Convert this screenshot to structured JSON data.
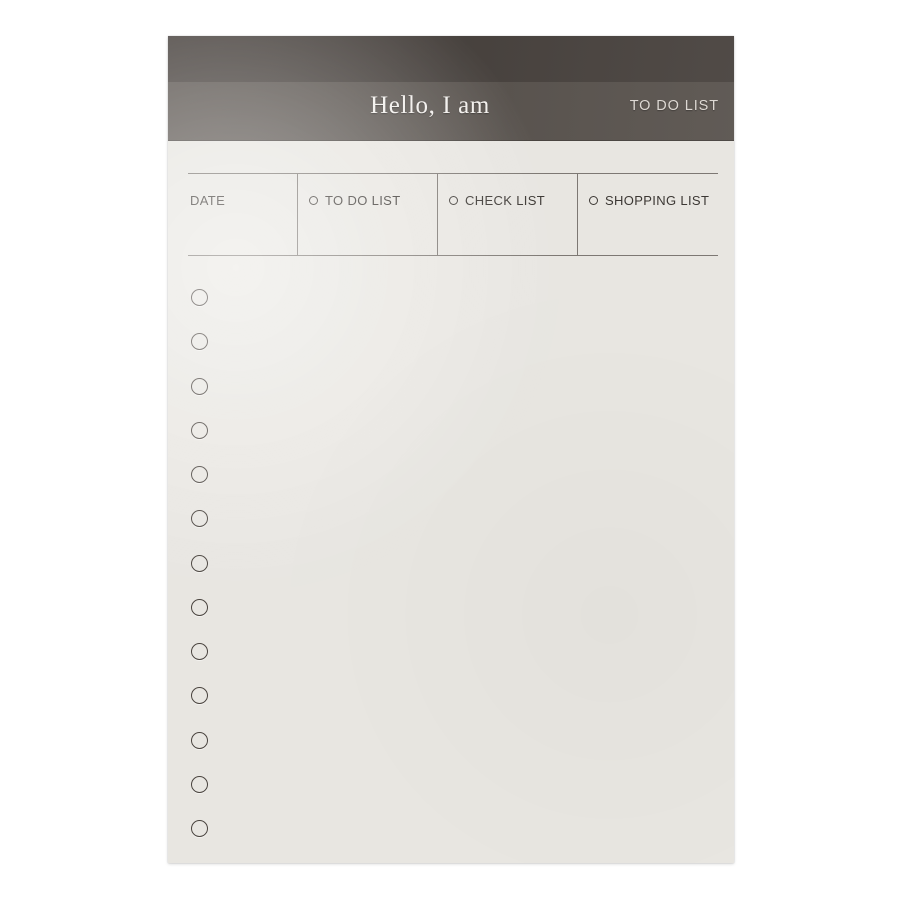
{
  "page": {
    "background_color": "#ffffff",
    "paper_color": "#e8e6e1"
  },
  "notepad": {
    "header": {
      "band_upper_color": "#4b4541",
      "band_lower_color": "#5d5752",
      "title": "Hello, I am",
      "tag_label": "TO DO LIST",
      "title_color": "#f2efec"
    },
    "meta": {
      "rule_color": "#7d7873",
      "date": {
        "label": "DATE",
        "value": ""
      },
      "categories": [
        {
          "label": "TO DO LIST",
          "checked": false,
          "marker": "circle-outline-icon"
        },
        {
          "label": "CHECK LIST",
          "checked": false,
          "marker": "circle-outline-icon"
        },
        {
          "label": "SHOPPING LIST",
          "checked": false,
          "marker": "circle-outline-icon"
        }
      ]
    },
    "list": {
      "marker": "circle-outline-icon",
      "marker_color": "#4a443f",
      "item_count": 13,
      "items": [
        {
          "index": 1,
          "checked": false,
          "text": ""
        },
        {
          "index": 2,
          "checked": false,
          "text": ""
        },
        {
          "index": 3,
          "checked": false,
          "text": ""
        },
        {
          "index": 4,
          "checked": false,
          "text": ""
        },
        {
          "index": 5,
          "checked": false,
          "text": ""
        },
        {
          "index": 6,
          "checked": false,
          "text": ""
        },
        {
          "index": 7,
          "checked": false,
          "text": ""
        },
        {
          "index": 8,
          "checked": false,
          "text": ""
        },
        {
          "index": 9,
          "checked": false,
          "text": ""
        },
        {
          "index": 10,
          "checked": false,
          "text": ""
        },
        {
          "index": 11,
          "checked": false,
          "text": ""
        },
        {
          "index": 12,
          "checked": false,
          "text": ""
        },
        {
          "index": 13,
          "checked": false,
          "text": ""
        }
      ]
    }
  }
}
